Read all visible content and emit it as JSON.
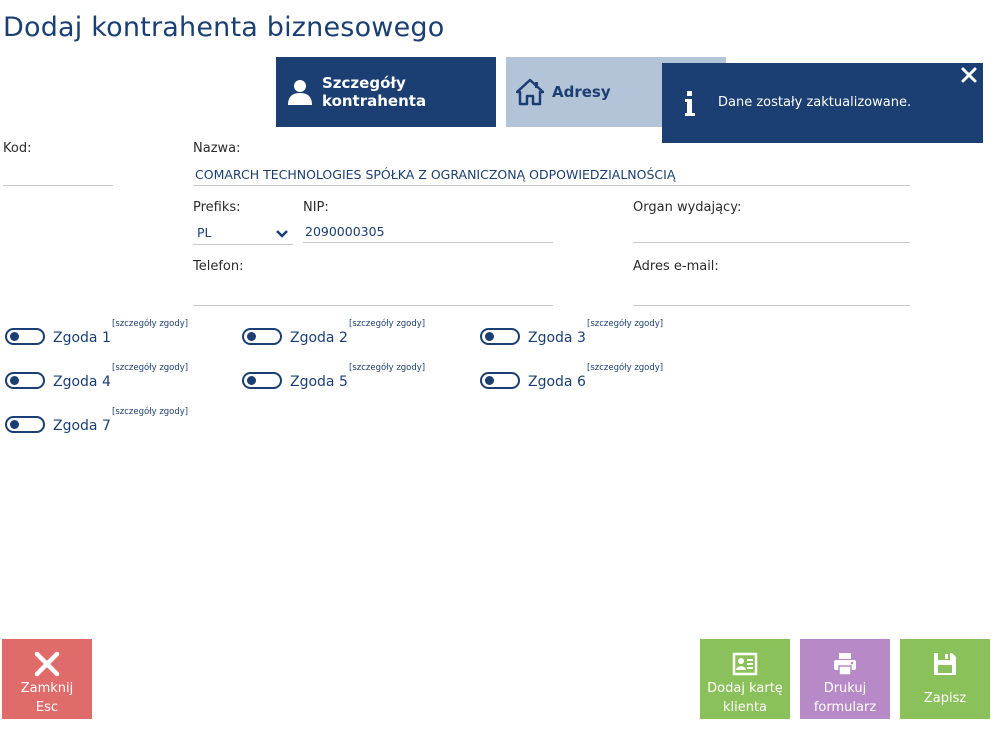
{
  "page": {
    "title": "Dodaj kontrahenta biznesowego"
  },
  "tabs": [
    {
      "label": "Szczegóły kontrahenta",
      "icon": "user-icon",
      "active": true
    },
    {
      "label": "Adresy",
      "icon": "home-icon",
      "active": false
    }
  ],
  "notification": {
    "message": "Dane zostały zaktualizowane.",
    "icon": "info-icon"
  },
  "form": {
    "kod_label": "Kod:",
    "kod_value": "",
    "nazwa_label": "Nazwa:",
    "nazwa_value": "COMARCH TECHNOLOGIES SPÓŁKA Z OGRANICZONĄ ODPOWIEDZIALNOŚCIĄ",
    "prefiks_label": "Prefiks:",
    "prefiks_value": "PL",
    "nip_label": "NIP:",
    "nip_value": "2090000305",
    "organ_label": "Organ wydający:",
    "organ_value": "",
    "telefon_label": "Telefon:",
    "telefon_value": "",
    "email_label": "Adres e-mail:",
    "email_value": ""
  },
  "consents": {
    "details_label": "[szczegóły zgody]",
    "items": [
      {
        "label": "Zgoda 1",
        "enabled": false
      },
      {
        "label": "Zgoda 2",
        "enabled": false
      },
      {
        "label": "Zgoda 3",
        "enabled": false
      },
      {
        "label": "Zgoda 4",
        "enabled": false
      },
      {
        "label": "Zgoda 5",
        "enabled": false
      },
      {
        "label": "Zgoda 6",
        "enabled": false
      },
      {
        "label": "Zgoda 7",
        "enabled": false
      }
    ]
  },
  "actions": {
    "close_line1": "Zamknij",
    "close_line2": "Esc",
    "card_line1": "Dodaj kartę",
    "card_line2": "klienta",
    "print_line1": "Drukuj",
    "print_line2": "formularz",
    "save": "Zapisz"
  },
  "colors": {
    "primary": "#1b3f73",
    "tab_inactive": "#b3c3d8",
    "close": "#e06b6b",
    "green": "#8bc15a",
    "purple": "#b78ac7"
  }
}
